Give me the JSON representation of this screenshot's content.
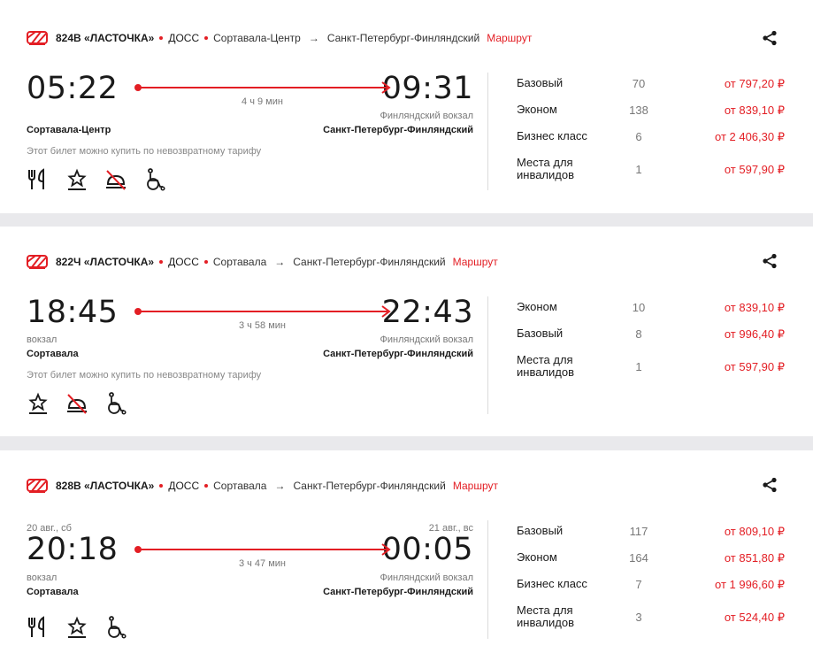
{
  "trains": [
    {
      "number": "824В «ЛАСТОЧКА»",
      "carrier": "ДОСС",
      "from": "Сортавала-Центр",
      "to": "Санкт-Петербург-Финляндский",
      "route_link": "Маршрут",
      "dep_date": "",
      "arr_date": "",
      "dep_time": "05:22",
      "arr_time": "09:31",
      "duration": "4 ч 9 мин",
      "dep_sub": "",
      "arr_sub": "Финляндский вокзал",
      "dep_station": "Сортавала-Центр",
      "arr_station": "Санкт-Петербург-Финляндский",
      "note": "Этот билет можно купить по невозвратному тарифу",
      "icons": [
        "restaurant-icon",
        "star-service-icon",
        "no-food-icon",
        "wheelchair-icon"
      ],
      "fares": [
        {
          "name": "Базовый",
          "count": "70",
          "price": "от 797,20 ₽"
        },
        {
          "name": "Эконом",
          "count": "138",
          "price": "от 839,10 ₽"
        },
        {
          "name": "Бизнес класс",
          "count": "6",
          "price": "от 2 406,30 ₽"
        },
        {
          "name": "Места для инвалидов",
          "count": "1",
          "price": "от 597,90 ₽"
        }
      ]
    },
    {
      "number": "822Ч «ЛАСТОЧКА»",
      "carrier": "ДОСС",
      "from": "Сортавала",
      "to": "Санкт-Петербург-Финляндский",
      "route_link": "Маршрут",
      "dep_date": "",
      "arr_date": "",
      "dep_time": "18:45",
      "arr_time": "22:43",
      "duration": "3 ч 58 мин",
      "dep_sub": "вокзал",
      "arr_sub": "Финляндский вокзал",
      "dep_station": "Сортавала",
      "arr_station": "Санкт-Петербург-Финляндский",
      "note": "Этот билет можно купить по невозвратному тарифу",
      "icons": [
        "star-service-icon",
        "no-food-icon",
        "wheelchair-icon"
      ],
      "fares": [
        {
          "name": "Эконом",
          "count": "10",
          "price": "от 839,10 ₽"
        },
        {
          "name": "Базовый",
          "count": "8",
          "price": "от 996,40 ₽"
        },
        {
          "name": "Места для инвалидов",
          "count": "1",
          "price": "от 597,90 ₽"
        }
      ]
    },
    {
      "number": "828В «ЛАСТОЧКА»",
      "carrier": "ДОСС",
      "from": "Сортавала",
      "to": "Санкт-Петербург-Финляндский",
      "route_link": "Маршрут",
      "dep_date": "20 авг., сб",
      "arr_date": "21 авг., вс",
      "dep_time": "20:18",
      "arr_time": "00:05",
      "duration": "3 ч 47 мин",
      "dep_sub": "вокзал",
      "arr_sub": "Финляндский вокзал",
      "dep_station": "Сортавала",
      "arr_station": "Санкт-Петербург-Финляндский",
      "note": "",
      "icons": [
        "restaurant-icon",
        "star-service-icon",
        "wheelchair-icon"
      ],
      "fares": [
        {
          "name": "Базовый",
          "count": "117",
          "price": "от 809,10 ₽"
        },
        {
          "name": "Эконом",
          "count": "164",
          "price": "от 851,80 ₽"
        },
        {
          "name": "Бизнес класс",
          "count": "7",
          "price": "от 1 996,60 ₽"
        },
        {
          "name": "Места для инвалидов",
          "count": "3",
          "price": "от 524,40 ₽"
        }
      ]
    }
  ],
  "colors": {
    "accent": "#e31e24",
    "text": "#1a1a1a",
    "muted": "#777777",
    "background": "#e9e9ec"
  }
}
